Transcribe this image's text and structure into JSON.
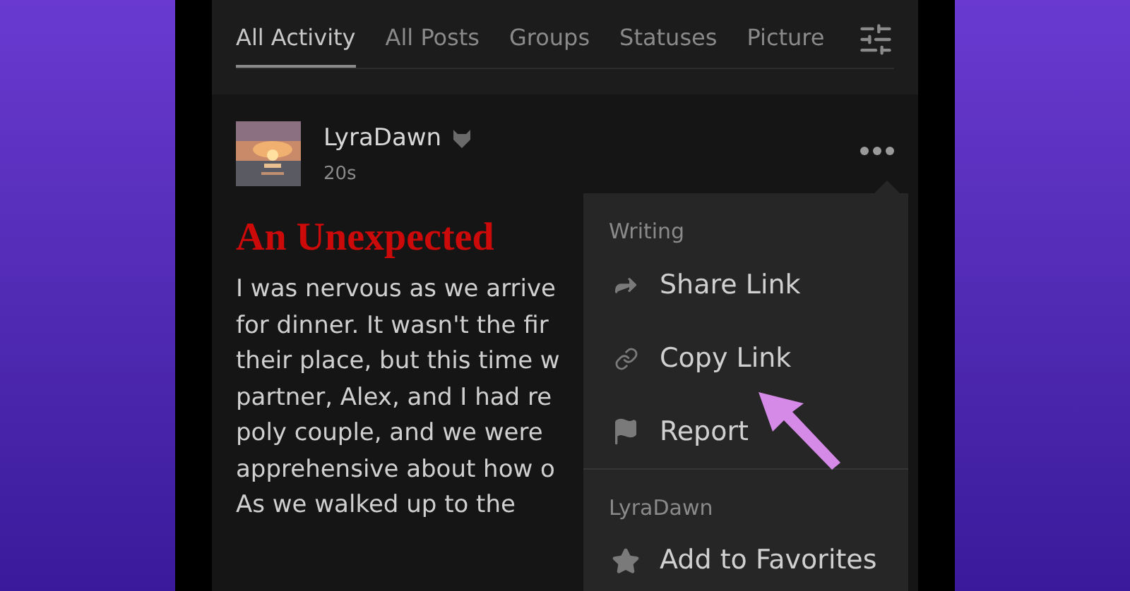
{
  "tabs": [
    {
      "label": "All Activity",
      "selected": true
    },
    {
      "label": "All Posts",
      "selected": false
    },
    {
      "label": "Groups",
      "selected": false
    },
    {
      "label": "Statuses",
      "selected": false
    },
    {
      "label": "Picture",
      "selected": false
    }
  ],
  "post": {
    "author": "LyraDawn",
    "time": "20s",
    "title": "An Unexpected",
    "body_lines": [
      "I was nervous as we arrive",
      "for dinner. It wasn't the fir",
      "their place, but this time w",
      "partner, Alex, and I had re",
      "poly couple, and we were",
      "apprehensive about how o",
      "As we walked up to the"
    ]
  },
  "menu": {
    "sections": [
      {
        "heading": "Writing",
        "items": [
          {
            "label": "Share Link",
            "kind": "share"
          },
          {
            "label": "Copy Link",
            "kind": "link"
          },
          {
            "label": "Report",
            "kind": "flag"
          }
        ]
      },
      {
        "heading": "LyraDawn",
        "items": [
          {
            "label": "Add to Favorites",
            "kind": "star"
          }
        ]
      }
    ]
  }
}
